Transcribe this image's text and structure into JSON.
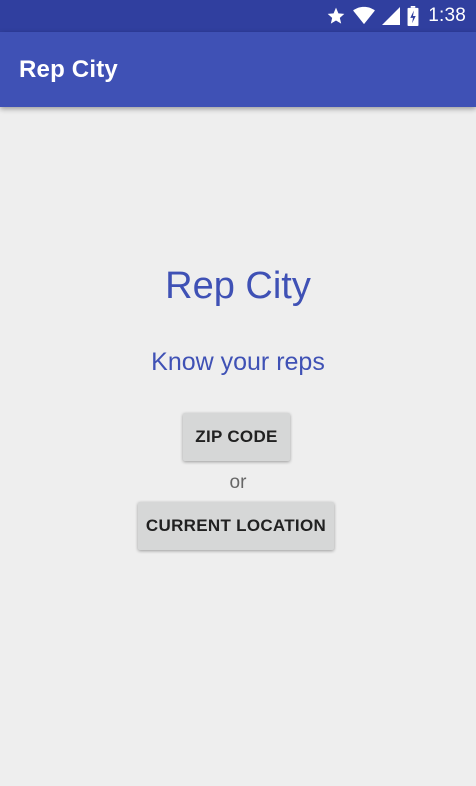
{
  "status_bar": {
    "time": "1:38",
    "icons": [
      "star-icon",
      "wifi-icon",
      "cell-signal-icon",
      "battery-charging-icon"
    ]
  },
  "app_bar": {
    "title": "Rep City"
  },
  "main": {
    "headline": "Rep City",
    "tagline": "Know your reps",
    "zip_button_label": "ZIP CODE",
    "or_label": "or",
    "location_button_label": "CURRENT LOCATION"
  },
  "colors": {
    "primary": "#3f51b5",
    "primary_dark": "#303f9f",
    "background": "#eeeeee",
    "button": "#d6d7d7"
  }
}
